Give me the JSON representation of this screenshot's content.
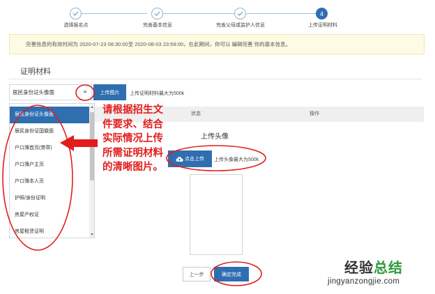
{
  "stepper": {
    "steps": [
      {
        "label": "选择报名点",
        "status": "done"
      },
      {
        "label": "完善基本信息",
        "status": "done"
      },
      {
        "label": "完善父母或监护人信息",
        "status": "done"
      },
      {
        "label": "上传证明材料",
        "status": "active",
        "number": "4"
      }
    ]
  },
  "notice": {
    "text": "完善信息的有效时间为 2020-07-23 08:30:00至 2020-08-03 23:59:00，在此期间，你可以 编辑完善 你的基本信息。"
  },
  "materials": {
    "section_title": "证明材料",
    "select_value": "居民身份证头像面",
    "upload_button": "上传图片",
    "upload_hint": "上传证明材料最大为500k",
    "options": [
      "居民身份证头像面",
      "居民身份证国徽面",
      "户口簿首页(带章)",
      "户口簿户主页",
      "户口簿本人页",
      "护照/身份证明",
      "房屋产权证",
      "房屋租赁证明"
    ],
    "table_headers": {
      "status": "状态",
      "action": "操作"
    }
  },
  "avatar": {
    "title": "上传头像",
    "upload_button": "点击上传",
    "upload_hint": "上传头像最大为500k"
  },
  "footer": {
    "prev_button": "上一步",
    "confirm_button": "确定完成"
  },
  "annotation": {
    "text": "请根据招生文件要求、结合实际情况上传所需证明材料的清晰图片。",
    "color": "#e21c1c"
  },
  "watermark": {
    "brand_part1": "经验",
    "brand_part2": "总结",
    "url": "jingyanzongjie.com"
  },
  "colors": {
    "primary": "#2f6fb0",
    "annotation_red": "#e21c1c",
    "notice_bg": "#fdfbe3"
  }
}
